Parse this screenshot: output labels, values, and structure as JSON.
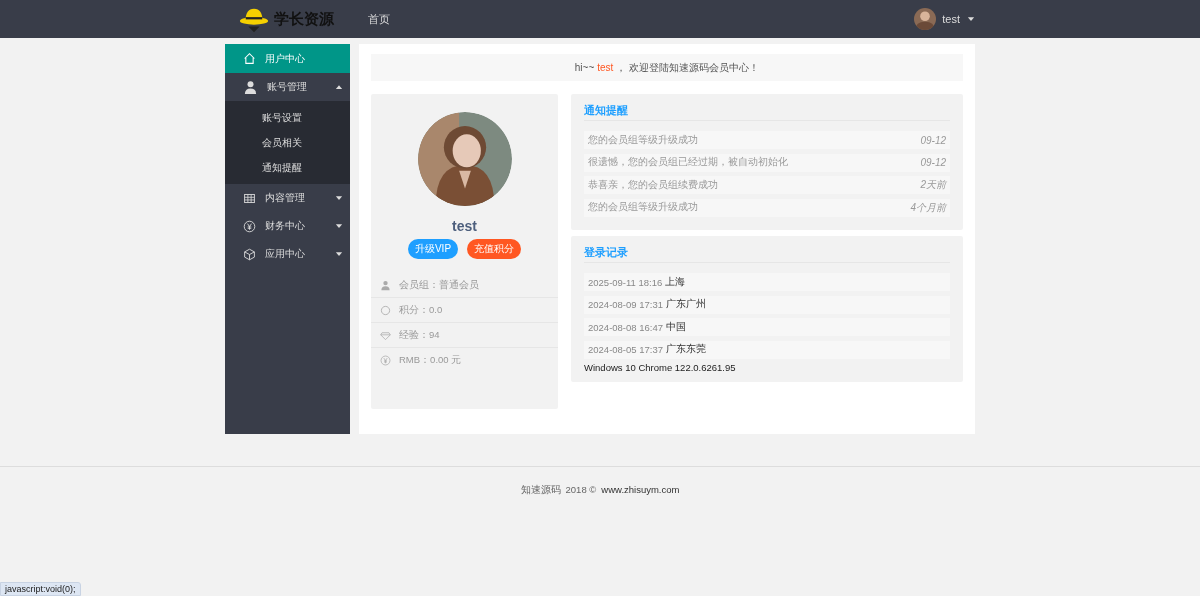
{
  "header": {
    "logo_text": "学长资源",
    "nav": [
      {
        "label": "首页",
        "selected": false
      }
    ],
    "user": {
      "name": "test"
    }
  },
  "sidebar": {
    "items": [
      {
        "label": "用户中心",
        "selected": true
      },
      {
        "label": "账号管理",
        "selected": false,
        "expanded": true,
        "children": [
          {
            "label": "账号设置",
            "selected": false
          },
          {
            "label": "会员相关",
            "selected": false
          },
          {
            "label": "通知提醒",
            "selected": false
          }
        ]
      },
      {
        "label": "内容管理",
        "selected": false,
        "expanded": false
      },
      {
        "label": "财务中心",
        "selected": false,
        "expanded": false
      },
      {
        "label": "应用中心",
        "selected": false,
        "expanded": false
      }
    ]
  },
  "welcome": {
    "greeting": "hi~~",
    "username": "test",
    "message": "， 欢迎登陆知速源码会员中心！"
  },
  "profile": {
    "name": "test",
    "buttons": [
      {
        "label": "升级VIP",
        "kind": "vip"
      },
      {
        "label": "充值积分",
        "kind": "recharge"
      }
    ],
    "info": [
      {
        "text": "会员组：普通会员"
      },
      {
        "text": "积分：0.0"
      },
      {
        "text": "经验：94"
      },
      {
        "text": "RMB：0.00 元"
      }
    ]
  },
  "notices": {
    "title": "通知提醒",
    "items": [
      {
        "text": "您的会员组等级升级成功",
        "time": "09-12"
      },
      {
        "text": "很遗憾，您的会员组已经过期，被自动初始化",
        "time": "09-12"
      },
      {
        "text": "恭喜亲，您的会员组续费成功",
        "time": "2天前"
      },
      {
        "text": "您的会员组等级升级成功",
        "time": "4个月前"
      }
    ]
  },
  "login_records": {
    "title": "登录记录",
    "items": [
      {
        "time": "2025-09-11 18:16",
        "place": "上海"
      },
      {
        "time": "2024-08-09 17:31",
        "place": "广东广州"
      },
      {
        "time": "2024-08-08 16:47",
        "place": "中国"
      },
      {
        "time": "2024-08-05 17:37",
        "place": "广东东莞"
      }
    ],
    "device": "Windows 10 Chrome 122.0.6261.95"
  },
  "footer": {
    "brand": "知速源码",
    "year": "2018 ©",
    "link": "www.zhisuym.com"
  },
  "status_bar": "javascript:void(0);"
}
